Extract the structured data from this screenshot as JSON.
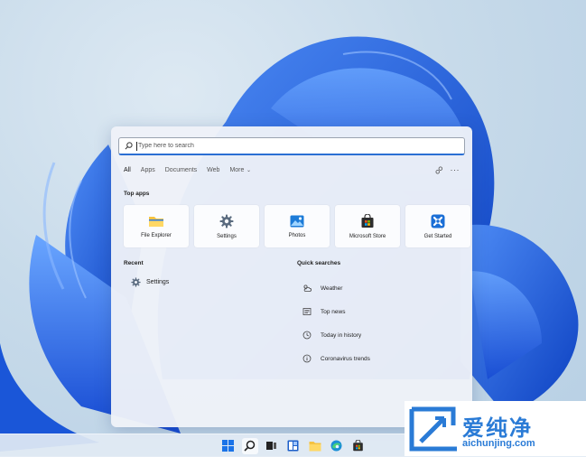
{
  "search": {
    "placeholder": "Type here to search"
  },
  "filters": [
    "All",
    "Apps",
    "Documents",
    "Web",
    "More"
  ],
  "sections": {
    "top_apps": "Top apps",
    "recent": "Recent",
    "quick_searches": "Quick searches"
  },
  "top_apps": [
    {
      "name": "File Explorer",
      "icon": "folder-icon"
    },
    {
      "name": "Settings",
      "icon": "gear-icon"
    },
    {
      "name": "Photos",
      "icon": "photos-icon"
    },
    {
      "name": "Microsoft Store",
      "icon": "store-bag-icon"
    },
    {
      "name": "Get Started",
      "icon": "get-started-icon"
    }
  ],
  "recent": [
    {
      "name": "Settings",
      "icon": "gear-icon"
    }
  ],
  "quick_searches": [
    {
      "label": "Weather",
      "icon": "weather-icon"
    },
    {
      "label": "Top news",
      "icon": "news-icon"
    },
    {
      "label": "Today in history",
      "icon": "clock-icon"
    },
    {
      "label": "Coronavirus trends",
      "icon": "info-icon"
    }
  ],
  "taskbar": [
    "start-icon",
    "search-icon",
    "task-view-icon",
    "widgets-icon",
    "file-explorer-icon",
    "edge-icon",
    "store-icon"
  ],
  "watermark": {
    "text": "爱纯净",
    "url": "aichunjing.com",
    "logo": "aichunjing-logo"
  },
  "colors": {
    "accent": "#2b6fd3",
    "panel": "#eef1f8",
    "wallpaper_blue": "#1f63e0",
    "watermark_blue": "#2a7bd6"
  }
}
